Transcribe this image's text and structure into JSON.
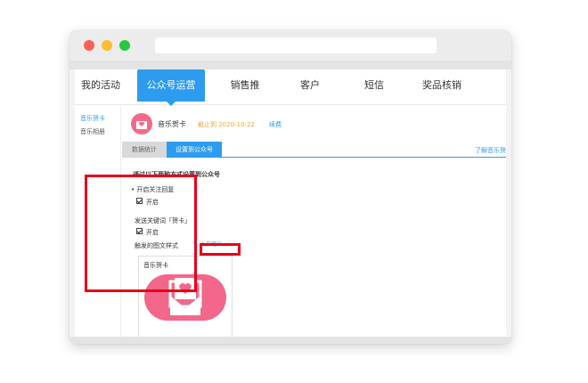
{
  "nav": {
    "items": [
      {
        "label": "我的活动"
      },
      {
        "label": "公众号运营"
      },
      {
        "label": "销售推"
      },
      {
        "label": "客户"
      },
      {
        "label": "短信"
      },
      {
        "label": "奖品核销"
      }
    ],
    "active_index": 1
  },
  "sidebar": {
    "items": [
      {
        "label": "音乐贺卡"
      },
      {
        "label": "音乐相册"
      }
    ]
  },
  "app": {
    "name": "音乐贺卡",
    "expiry": "截止到 2020-10-22",
    "renew": "续费"
  },
  "tabs": {
    "stats": "数据统计",
    "setup": "设置到公众号",
    "learn_more": "了解音乐贺"
  },
  "content": {
    "instruction": "通过以下两种方式设置到公众号",
    "follow_reply_label": "开启关注回复",
    "follow_reply_enable": "开启",
    "keyword_label": "发送关键词「贺卡」",
    "keyword_enable": "开启",
    "message_style_label": "触发的图文样式",
    "customize_button": "自定义",
    "card_title": "音乐贺卡"
  },
  "colors": {
    "accent": "#2d9cee",
    "highlight": "#e50019",
    "brand_pink": "#f2678a",
    "expiry": "#f5a623"
  }
}
